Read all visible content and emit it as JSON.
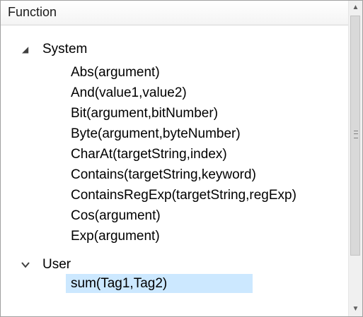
{
  "panel": {
    "header_label": "Function",
    "groups": [
      {
        "label": "System",
        "expanded": true,
        "items": [
          "Abs(argument)",
          "And(value1,value2)",
          "Bit(argument,bitNumber)",
          "Byte(argument,byteNumber)",
          "CharAt(targetString,index)",
          "Contains(targetString,keyword)",
          "ContainsRegExp(targetString,regExp)",
          "Cos(argument)",
          "Exp(argument)"
        ]
      },
      {
        "label": "User",
        "expanded": true,
        "items": [
          "sum(Tag1,Tag2)"
        ],
        "selected_item": "sum(Tag1,Tag2)"
      }
    ]
  },
  "icons": {
    "system_arrow": "expanded-triangle-icon",
    "user_arrow": "chevron-down-icon",
    "scroll_up": "scroll-up-arrow-icon",
    "scroll_down": "scroll-down-arrow-icon"
  },
  "colors": {
    "selection": "#cce8ff",
    "border": "#a0a0a0",
    "scrollbar_track": "#f0f0f0",
    "scrollbar_thumb": "#d9d9d9"
  }
}
